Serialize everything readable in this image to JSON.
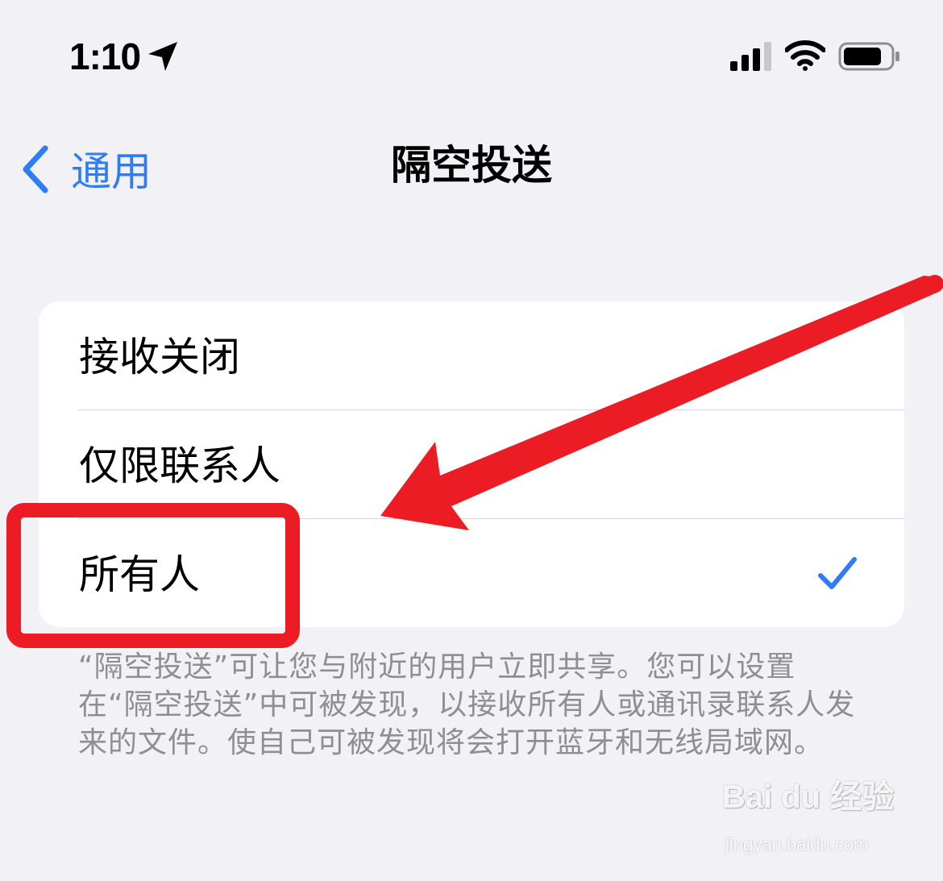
{
  "status_bar": {
    "time": "1:10",
    "icons": [
      "location-arrow-icon",
      "cellular-signal-icon",
      "wifi-icon",
      "battery-icon"
    ]
  },
  "nav": {
    "back_label": "通用",
    "title": "隔空投送"
  },
  "options": [
    {
      "label": "接收关闭",
      "selected": false
    },
    {
      "label": "仅限联系人",
      "selected": false
    },
    {
      "label": "所有人",
      "selected": true
    }
  ],
  "footer_note": "“隔空投送”可让您与附近的用户立即共享。您可以设置在“隔空投送”中可被发现，以接收所有人或通讯录联系人发来的文件。使自己可被发现将会打开蓝牙和无线局域网。",
  "colors": {
    "accent": "#2f7cf6",
    "background": "#f1f1f6",
    "card": "#ffffff",
    "annotation": "#ec1c24",
    "secondary_text": "#8e8e93"
  },
  "annotation": {
    "arrow": "red-arrow pointing at 所有人 row",
    "highlight": "red rounded box around 所有人"
  },
  "watermark": {
    "logo": "Bai du 经验",
    "url": "jingyan.baidu.com"
  }
}
